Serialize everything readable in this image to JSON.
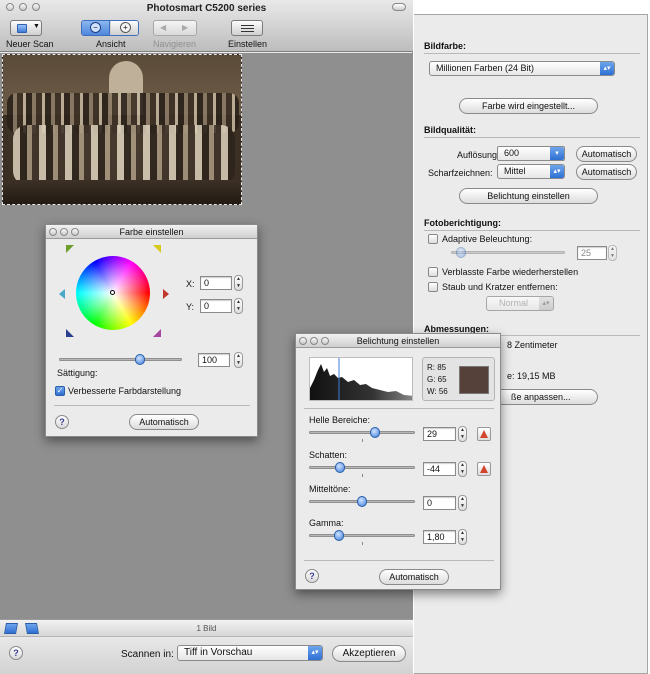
{
  "window": {
    "title": "Photosmart C5200 series"
  },
  "toolbar": {
    "new_scan": "Neuer Scan",
    "view": "Ansicht",
    "navigate": "Navigieren",
    "settings": "Einstellen"
  },
  "status": {
    "image_count": "1 Bild"
  },
  "bottom": {
    "scan_in_label": "Scannen in:",
    "scan_in_value": "Tiff in Vorschau",
    "accept": "Akzeptieren"
  },
  "sidebar": {
    "color_header": "Bildfarbe:",
    "color_value": "Millionen Farben (24 Bit)",
    "color_button": "Farbe wird eingestellt...",
    "quality_header": "Bildqualität:",
    "resolution_label": "Auflösung:",
    "resolution_value": "600",
    "sharpen_label": "Scharfzeichnen:",
    "sharpen_value": "Mittel",
    "auto": "Automatisch",
    "exposure_button": "Belichtung einstellen",
    "photo_header": "Fotoberichtigung:",
    "adaptive": "Adaptive Beleuchtung:",
    "adaptive_value": "25",
    "faded": "Verblasste Farbe wiederherstellen",
    "dust": "Staub und Kratzer entfernen:",
    "dust_value": "Normal",
    "dims_header": "Abmessungen:",
    "dims_unit": "8 Zentimeter",
    "file_size": "e: 19,15 MB",
    "fit_button": "ße anpassen..."
  },
  "color_panel": {
    "title": "Farbe einstellen",
    "x_label": "X:",
    "x_value": "0",
    "y_label": "Y:",
    "y_value": "0",
    "saturation_label": "Sättigung:",
    "saturation_value": "100",
    "enhanced": "Verbesserte Farbdarstellung",
    "auto": "Automatisch",
    "saturation_fraction": 0.66,
    "wheel_colors": [
      "#ff0000",
      "#ffff00",
      "#00ff00",
      "#00ffff",
      "#0000ff",
      "#ff00ff"
    ],
    "arrow_colors": {
      "top_left": "#6b9e2b",
      "top_right": "#d8c91d",
      "left": "#4aa7c7",
      "right": "#c0392b",
      "bottom_left": "#2b3f8f",
      "bottom_right": "#a547a0"
    }
  },
  "exposure_panel": {
    "title": "Belichtung einstellen",
    "r": "R: 85",
    "g": "G: 65",
    "w": "W: 56",
    "swatch_color": "#554139",
    "highlights_label": "Helle Bereiche:",
    "highlights_value": "29",
    "highlights_fraction": 0.62,
    "shadows_label": "Schatten:",
    "shadows_value": "-44",
    "shadows_fraction": 0.29,
    "midtones_label": "Mitteltöne:",
    "midtones_value": "0",
    "midtones_fraction": 0.5,
    "gamma_label": "Gamma:",
    "gamma_value": "1,80",
    "gamma_fraction": 0.28,
    "auto": "Automatisch"
  },
  "colors": {
    "preview_bg": "#8e8f8e",
    "sidebar_bg": "#ebebeb",
    "accent_blue": "#3b7bdb"
  }
}
